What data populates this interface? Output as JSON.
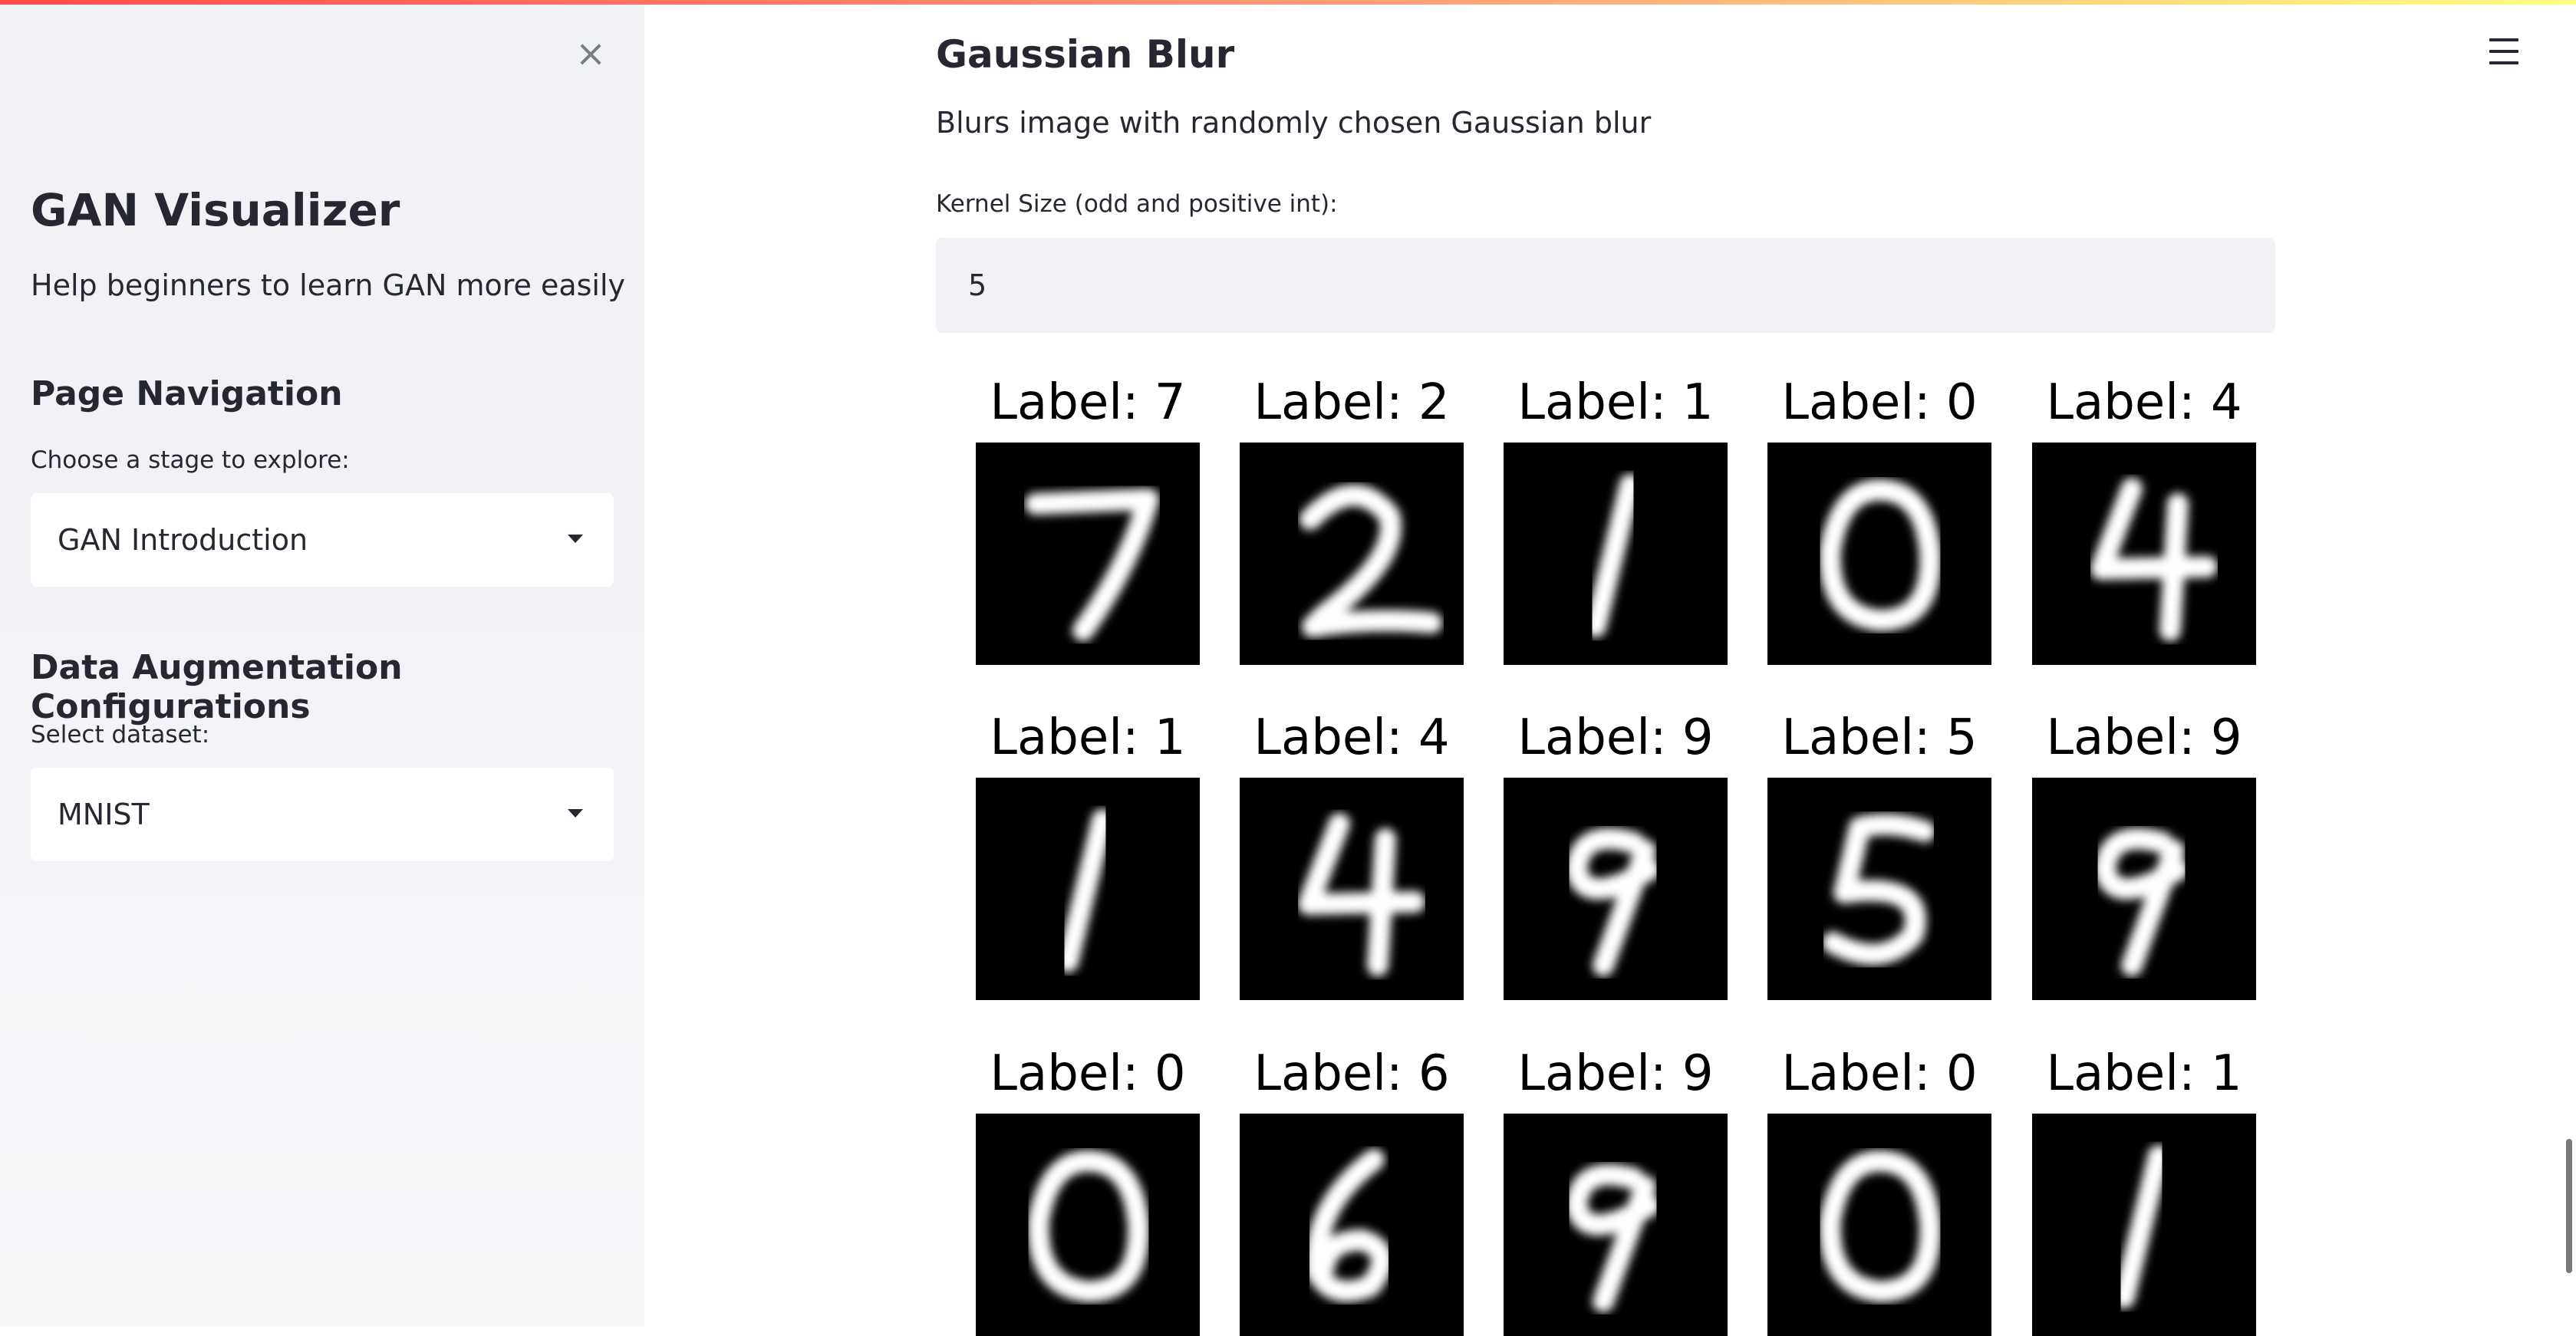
{
  "sidebar": {
    "title": "GAN Visualizer",
    "subtitle": "Help beginners to learn GAN more easily",
    "close_icon": "×",
    "nav_heading": "Page Navigation",
    "nav_label": "Choose a stage to explore:",
    "nav_value": "GAN Introduction",
    "aug_heading": "Data Augmentation Configurations",
    "dataset_label": "Select dataset:",
    "dataset_value": "MNIST"
  },
  "main": {
    "title": "Gaussian Blur",
    "description": "Blurs image with randomly chosen Gaussian blur",
    "kernel_label": "Kernel Size (odd and positive int):",
    "kernel_value": "5"
  },
  "samples": [
    {
      "label": "Label: 7",
      "digit": "7"
    },
    {
      "label": "Label: 2",
      "digit": "2"
    },
    {
      "label": "Label: 1",
      "digit": "1"
    },
    {
      "label": "Label: 0",
      "digit": "0"
    },
    {
      "label": "Label: 4",
      "digit": "4"
    },
    {
      "label": "Label: 1",
      "digit": "1"
    },
    {
      "label": "Label: 4",
      "digit": "4"
    },
    {
      "label": "Label: 9",
      "digit": "9"
    },
    {
      "label": "Label: 5",
      "digit": "5"
    },
    {
      "label": "Label: 9",
      "digit": "9"
    },
    {
      "label": "Label: 0",
      "digit": "0"
    },
    {
      "label": "Label: 6",
      "digit": "6"
    },
    {
      "label": "Label: 9",
      "digit": "9"
    },
    {
      "label": "Label: 0",
      "digit": "0"
    },
    {
      "label": "Label: 1",
      "digit": "1"
    }
  ],
  "colors": {
    "accent_gradient_start": "#ff4b4b",
    "accent_gradient_end": "#fffd80",
    "sidebar_bg": "#f0f2f6",
    "text": "#262730"
  }
}
